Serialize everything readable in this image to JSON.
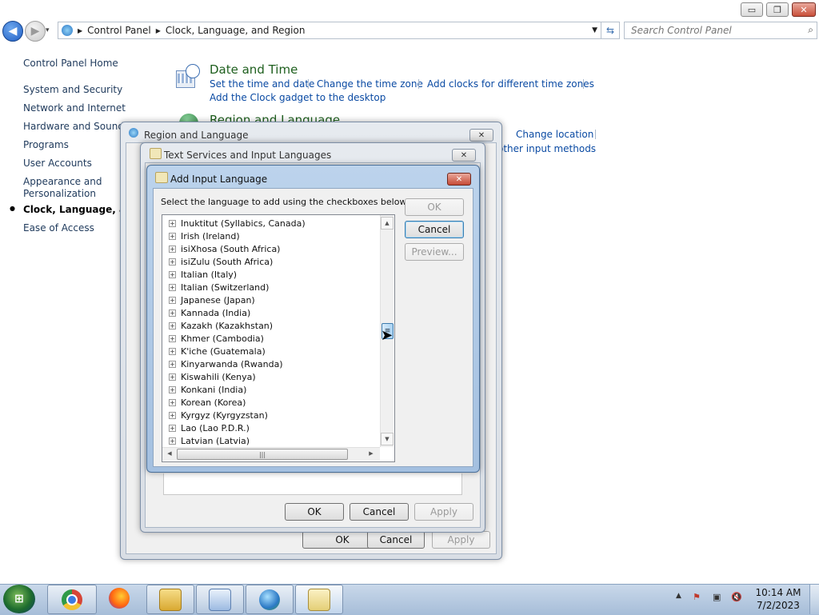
{
  "window": {
    "caption_buttons": {
      "minimize": "▭",
      "maximize": "❐",
      "close": "✕"
    }
  },
  "nav": {
    "back_glyph": "◀",
    "forward_glyph": "▶",
    "recent_glyph": "▾",
    "breadcrumbs": [
      "Control Panel",
      "Clock, Language, and Region"
    ],
    "refresh_glyph": "⇆",
    "search_placeholder": "Search Control Panel",
    "search_icon": "magnifier-icon"
  },
  "sidebar": {
    "home": "Control Panel Home",
    "items": [
      "System and Security",
      "Network and Internet",
      "Hardware and Sound",
      "Programs",
      "User Accounts",
      "Appearance and",
      "Personalization",
      "Clock, Language, and Region",
      "Ease of Access"
    ]
  },
  "main": {
    "date_time": {
      "title": "Date and Time",
      "links": [
        "Set the time and date",
        "Change the time zone",
        "Add clocks for different time zones",
        "Add the Clock gadget to the desktop"
      ]
    },
    "region_language": {
      "title": "Region and Language",
      "links": [
        "Change location",
        "other input methods"
      ]
    }
  },
  "dialogs": {
    "region": {
      "title": "Region and Language",
      "ok": "OK",
      "cancel": "Cancel",
      "apply": "Apply"
    },
    "text_services": {
      "title": "Text Services and Input Languages",
      "ok": "OK",
      "cancel": "Cancel",
      "apply": "Apply"
    },
    "add_input": {
      "title": "Add Input Language",
      "instruction": "Select the language to add using the checkboxes below.",
      "ok": "OK",
      "cancel": "Cancel",
      "preview": "Preview...",
      "languages": [
        "Inuktitut (Syllabics, Canada)",
        "Irish (Ireland)",
        "isiXhosa (South Africa)",
        "isiZulu (South Africa)",
        "Italian (Italy)",
        "Italian (Switzerland)",
        "Japanese (Japan)",
        "Kannada (India)",
        "Kazakh (Kazakhstan)",
        "Khmer (Cambodia)",
        "K'iche (Guatemala)",
        "Kinyarwanda (Rwanda)",
        "Kiswahili (Kenya)",
        "Konkani (India)",
        "Korean (Korea)",
        "Kyrgyz (Kyrgyzstan)",
        "Lao (Lao P.D.R.)",
        "Latvian (Latvia)"
      ],
      "scroll": {
        "up": "▲",
        "down": "▼",
        "left": "◀",
        "right": "▶",
        "grip": "≡",
        "hgrip": "|||"
      }
    }
  },
  "taskbar": {
    "start_glyph": "⊞",
    "apps": [
      "chrome-icon",
      "firefox-icon",
      "explorer-icon",
      "control-panel-icon",
      "region-globe-icon",
      "keyboard-icon"
    ],
    "tray": {
      "chevron": "▲",
      "flag": "⚑",
      "network": "▣",
      "volume": "🔇"
    },
    "time": "10:14 AM",
    "date": "7/2/2023"
  },
  "colors": {
    "link": "#0a4aa3",
    "category_title": "#1e5f1e",
    "taskbar": "#b7cbe3"
  }
}
